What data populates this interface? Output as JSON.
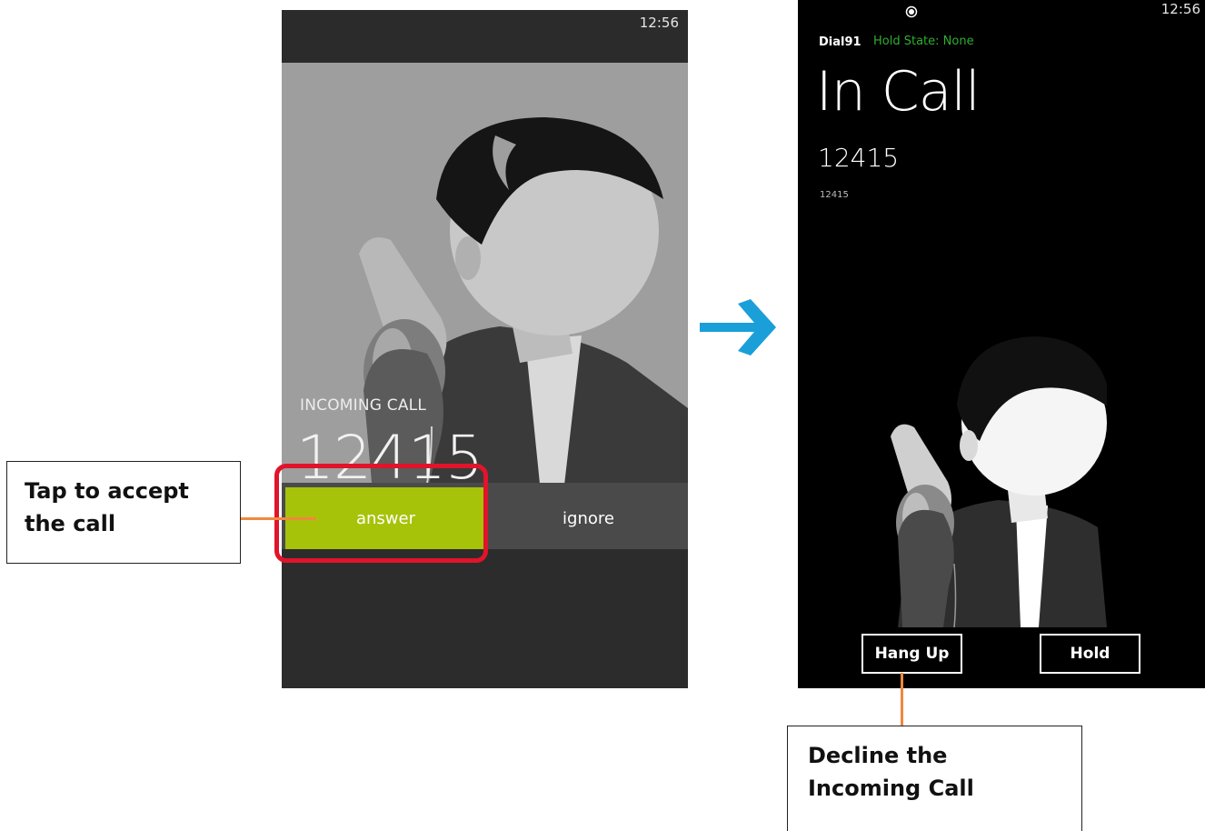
{
  "incoming_screen": {
    "status_time": "12:56",
    "label": "INCOMING CALL",
    "number": "12415",
    "answer_label": "answer",
    "ignore_label": "ignore",
    "accent_color": "#a6c30a"
  },
  "in_call_screen": {
    "status_time": "12:56",
    "app_name": "Dial91",
    "hold_state": "Hold State: None",
    "title": "In Call",
    "number": "12415",
    "number_small": "12415",
    "hangup_label": "Hang Up",
    "hold_label": "Hold"
  },
  "annotations": {
    "accept_text_line1": "Tap to accept",
    "accept_text_line2": "the call",
    "decline_text_line1": "Decline the",
    "decline_text_line2": "Incoming Call",
    "highlight_color": "#e0142a",
    "leader_color": "#f0883e",
    "arrow_color": "#1a9fd9"
  },
  "icons": {
    "flow_arrow": "right-arrow-icon",
    "status_indicator": "radio-dot-icon",
    "caller_avatar": "person-on-phone-icon"
  }
}
